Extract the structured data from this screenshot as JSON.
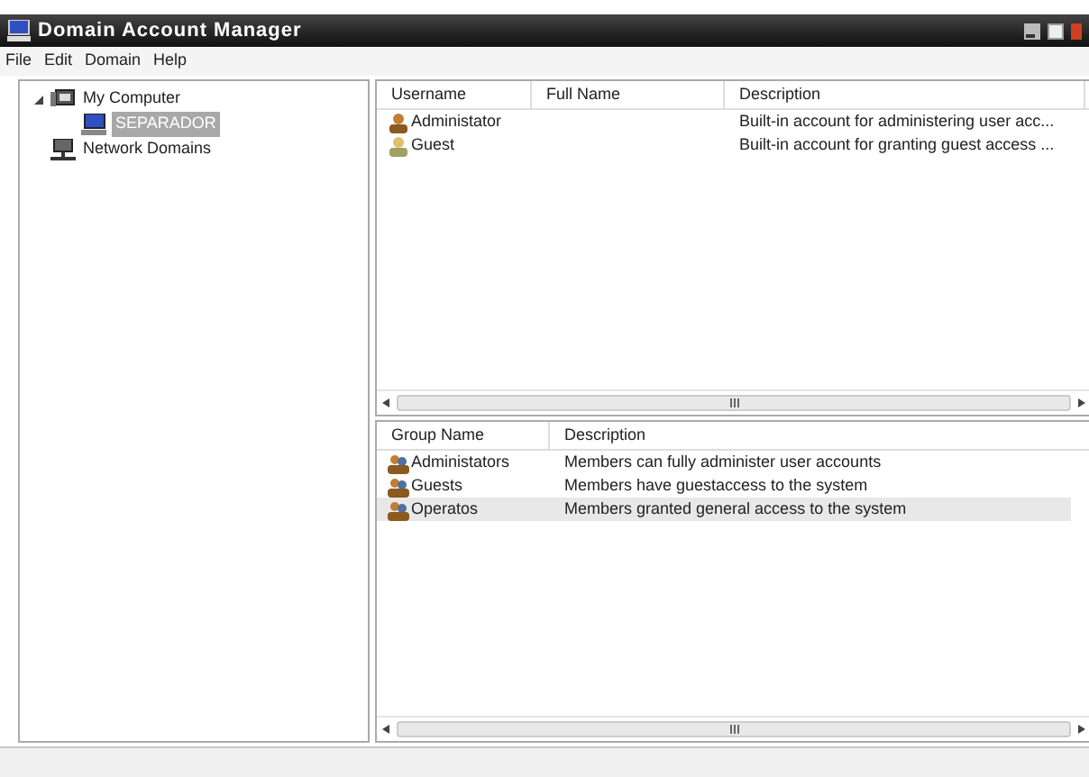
{
  "window": {
    "title": "Domain Account Manager"
  },
  "menu": [
    "File",
    "Edit",
    "Domain",
    "Help"
  ],
  "tree": [
    {
      "label": "My Computer",
      "kind": "computer",
      "expanded": true,
      "selected": false,
      "children": [
        {
          "label": "SEPARADOR",
          "kind": "pc",
          "selected": true
        }
      ]
    },
    {
      "label": "Network Domains",
      "kind": "network",
      "selected": false
    }
  ],
  "users": {
    "columns": [
      "Username",
      "Full Name",
      "Description"
    ],
    "rows": [
      {
        "username": "Administator",
        "kind": "admin",
        "description": "Built-in account for administering user acc...",
        "selected": false
      },
      {
        "username": "Guest",
        "kind": "guest",
        "description": "Built-in account for granting guest access ...",
        "selected": false
      }
    ]
  },
  "groups": {
    "columns": [
      "Group Name",
      "Description"
    ],
    "rows": [
      {
        "name": "Administators",
        "description": "Members can fully administer user accounts",
        "selected": false
      },
      {
        "name": "Guests",
        "description": "Members have guestaccess to the system",
        "selected": false
      },
      {
        "name": "Operatos",
        "description": "Members granted general access to the system",
        "selected": true
      }
    ]
  }
}
